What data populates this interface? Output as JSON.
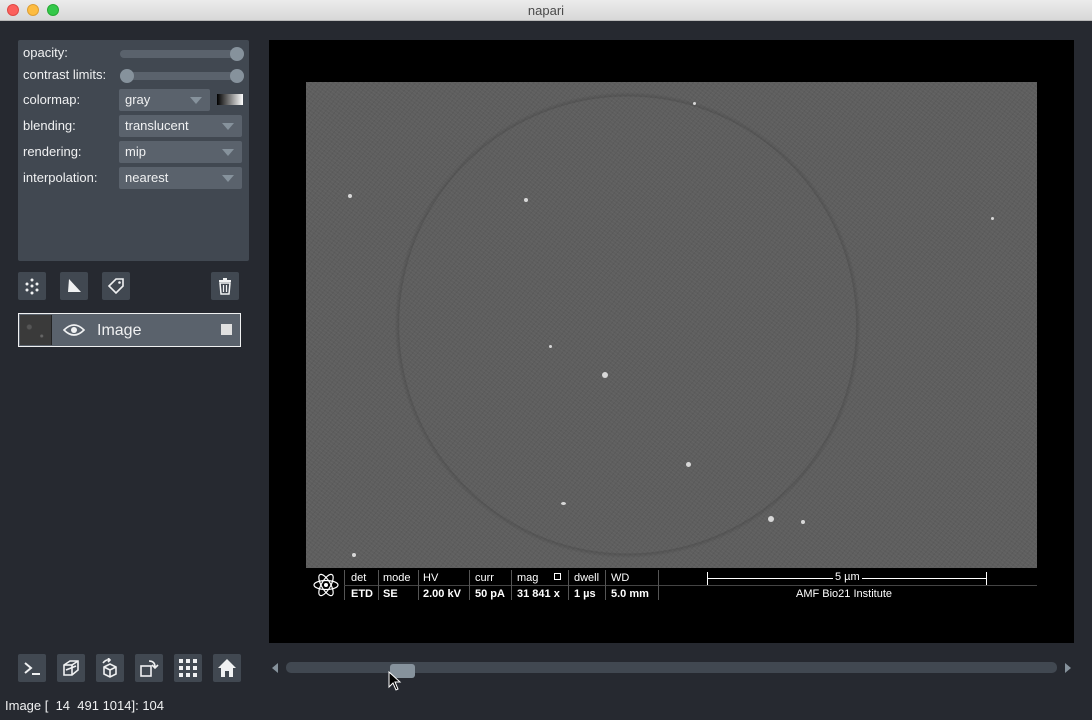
{
  "window": {
    "title": "napari"
  },
  "layer_controls": {
    "opacity_label": "opacity:",
    "opacity_value": 1.0,
    "contrast_label": "contrast limits:",
    "contrast_range": [
      0.0,
      1.0
    ],
    "colormap_label": "colormap:",
    "colormap_value": "gray",
    "blending_label": "blending:",
    "blending_value": "translucent",
    "rendering_label": "rendering:",
    "rendering_value": "mip",
    "interpolation_label": "interpolation:",
    "interpolation_value": "nearest"
  },
  "layer_buttons": {
    "new_points_icon": "points-icon",
    "new_shapes_icon": "shapes-icon",
    "new_labels_icon": "labels-tag-icon",
    "delete_icon": "trash-icon"
  },
  "layers": [
    {
      "name": "Image",
      "visible": true,
      "selected": true
    }
  ],
  "viewer_buttons": [
    "console-icon",
    "ndisplay-icon",
    "roll-dims-icon",
    "transpose-icon",
    "grid-icon",
    "home-icon"
  ],
  "sem_databar": {
    "det_label": "det",
    "det_value": "ETD",
    "mode_label": "mode",
    "mode_value": "SE",
    "hv_label": "HV",
    "hv_value": "2.00 kV",
    "curr_label": "curr",
    "curr_value": "50 pA",
    "mag_label": "mag",
    "mag_value": "31 841 x",
    "dwell_label": "dwell",
    "dwell_value": "1 µs",
    "wd_label": "WD",
    "wd_value": "5.0 mm",
    "scale_label": "5 µm",
    "institute": "AMF Bio21 Institute"
  },
  "dims_slider": {
    "position_fraction": 0.14
  },
  "status": {
    "text": "Image [  14  491 1014]: 104"
  },
  "colors": {
    "background": "#262930",
    "panel": "#414851",
    "control": "#5a626c",
    "accent": "#86929c",
    "text": "#f0f1f2"
  }
}
